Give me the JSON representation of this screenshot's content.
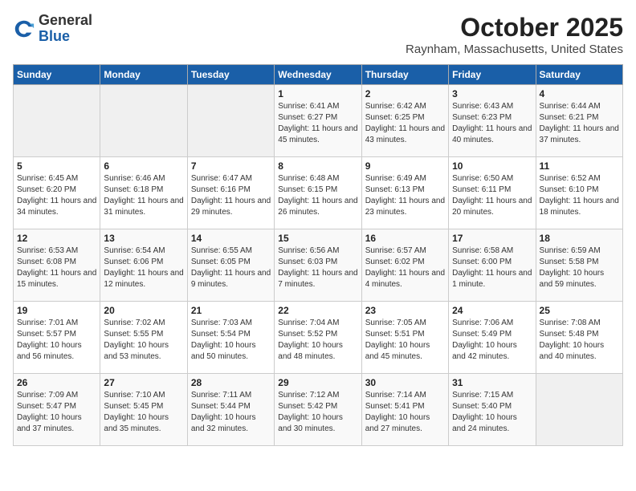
{
  "header": {
    "logo_general": "General",
    "logo_blue": "Blue",
    "month": "October 2025",
    "location": "Raynham, Massachusetts, United States"
  },
  "weekdays": [
    "Sunday",
    "Monday",
    "Tuesday",
    "Wednesday",
    "Thursday",
    "Friday",
    "Saturday"
  ],
  "weeks": [
    [
      {
        "day": "",
        "sunrise": "",
        "sunset": "",
        "daylight": ""
      },
      {
        "day": "",
        "sunrise": "",
        "sunset": "",
        "daylight": ""
      },
      {
        "day": "",
        "sunrise": "",
        "sunset": "",
        "daylight": ""
      },
      {
        "day": "1",
        "sunrise": "Sunrise: 6:41 AM",
        "sunset": "Sunset: 6:27 PM",
        "daylight": "Daylight: 11 hours and 45 minutes."
      },
      {
        "day": "2",
        "sunrise": "Sunrise: 6:42 AM",
        "sunset": "Sunset: 6:25 PM",
        "daylight": "Daylight: 11 hours and 43 minutes."
      },
      {
        "day": "3",
        "sunrise": "Sunrise: 6:43 AM",
        "sunset": "Sunset: 6:23 PM",
        "daylight": "Daylight: 11 hours and 40 minutes."
      },
      {
        "day": "4",
        "sunrise": "Sunrise: 6:44 AM",
        "sunset": "Sunset: 6:21 PM",
        "daylight": "Daylight: 11 hours and 37 minutes."
      }
    ],
    [
      {
        "day": "5",
        "sunrise": "Sunrise: 6:45 AM",
        "sunset": "Sunset: 6:20 PM",
        "daylight": "Daylight: 11 hours and 34 minutes."
      },
      {
        "day": "6",
        "sunrise": "Sunrise: 6:46 AM",
        "sunset": "Sunset: 6:18 PM",
        "daylight": "Daylight: 11 hours and 31 minutes."
      },
      {
        "day": "7",
        "sunrise": "Sunrise: 6:47 AM",
        "sunset": "Sunset: 6:16 PM",
        "daylight": "Daylight: 11 hours and 29 minutes."
      },
      {
        "day": "8",
        "sunrise": "Sunrise: 6:48 AM",
        "sunset": "Sunset: 6:15 PM",
        "daylight": "Daylight: 11 hours and 26 minutes."
      },
      {
        "day": "9",
        "sunrise": "Sunrise: 6:49 AM",
        "sunset": "Sunset: 6:13 PM",
        "daylight": "Daylight: 11 hours and 23 minutes."
      },
      {
        "day": "10",
        "sunrise": "Sunrise: 6:50 AM",
        "sunset": "Sunset: 6:11 PM",
        "daylight": "Daylight: 11 hours and 20 minutes."
      },
      {
        "day": "11",
        "sunrise": "Sunrise: 6:52 AM",
        "sunset": "Sunset: 6:10 PM",
        "daylight": "Daylight: 11 hours and 18 minutes."
      }
    ],
    [
      {
        "day": "12",
        "sunrise": "Sunrise: 6:53 AM",
        "sunset": "Sunset: 6:08 PM",
        "daylight": "Daylight: 11 hours and 15 minutes."
      },
      {
        "day": "13",
        "sunrise": "Sunrise: 6:54 AM",
        "sunset": "Sunset: 6:06 PM",
        "daylight": "Daylight: 11 hours and 12 minutes."
      },
      {
        "day": "14",
        "sunrise": "Sunrise: 6:55 AM",
        "sunset": "Sunset: 6:05 PM",
        "daylight": "Daylight: 11 hours and 9 minutes."
      },
      {
        "day": "15",
        "sunrise": "Sunrise: 6:56 AM",
        "sunset": "Sunset: 6:03 PM",
        "daylight": "Daylight: 11 hours and 7 minutes."
      },
      {
        "day": "16",
        "sunrise": "Sunrise: 6:57 AM",
        "sunset": "Sunset: 6:02 PM",
        "daylight": "Daylight: 11 hours and 4 minutes."
      },
      {
        "day": "17",
        "sunrise": "Sunrise: 6:58 AM",
        "sunset": "Sunset: 6:00 PM",
        "daylight": "Daylight: 11 hours and 1 minute."
      },
      {
        "day": "18",
        "sunrise": "Sunrise: 6:59 AM",
        "sunset": "Sunset: 5:58 PM",
        "daylight": "Daylight: 10 hours and 59 minutes."
      }
    ],
    [
      {
        "day": "19",
        "sunrise": "Sunrise: 7:01 AM",
        "sunset": "Sunset: 5:57 PM",
        "daylight": "Daylight: 10 hours and 56 minutes."
      },
      {
        "day": "20",
        "sunrise": "Sunrise: 7:02 AM",
        "sunset": "Sunset: 5:55 PM",
        "daylight": "Daylight: 10 hours and 53 minutes."
      },
      {
        "day": "21",
        "sunrise": "Sunrise: 7:03 AM",
        "sunset": "Sunset: 5:54 PM",
        "daylight": "Daylight: 10 hours and 50 minutes."
      },
      {
        "day": "22",
        "sunrise": "Sunrise: 7:04 AM",
        "sunset": "Sunset: 5:52 PM",
        "daylight": "Daylight: 10 hours and 48 minutes."
      },
      {
        "day": "23",
        "sunrise": "Sunrise: 7:05 AM",
        "sunset": "Sunset: 5:51 PM",
        "daylight": "Daylight: 10 hours and 45 minutes."
      },
      {
        "day": "24",
        "sunrise": "Sunrise: 7:06 AM",
        "sunset": "Sunset: 5:49 PM",
        "daylight": "Daylight: 10 hours and 42 minutes."
      },
      {
        "day": "25",
        "sunrise": "Sunrise: 7:08 AM",
        "sunset": "Sunset: 5:48 PM",
        "daylight": "Daylight: 10 hours and 40 minutes."
      }
    ],
    [
      {
        "day": "26",
        "sunrise": "Sunrise: 7:09 AM",
        "sunset": "Sunset: 5:47 PM",
        "daylight": "Daylight: 10 hours and 37 minutes."
      },
      {
        "day": "27",
        "sunrise": "Sunrise: 7:10 AM",
        "sunset": "Sunset: 5:45 PM",
        "daylight": "Daylight: 10 hours and 35 minutes."
      },
      {
        "day": "28",
        "sunrise": "Sunrise: 7:11 AM",
        "sunset": "Sunset: 5:44 PM",
        "daylight": "Daylight: 10 hours and 32 minutes."
      },
      {
        "day": "29",
        "sunrise": "Sunrise: 7:12 AM",
        "sunset": "Sunset: 5:42 PM",
        "daylight": "Daylight: 10 hours and 30 minutes."
      },
      {
        "day": "30",
        "sunrise": "Sunrise: 7:14 AM",
        "sunset": "Sunset: 5:41 PM",
        "daylight": "Daylight: 10 hours and 27 minutes."
      },
      {
        "day": "31",
        "sunrise": "Sunrise: 7:15 AM",
        "sunset": "Sunset: 5:40 PM",
        "daylight": "Daylight: 10 hours and 24 minutes."
      },
      {
        "day": "",
        "sunrise": "",
        "sunset": "",
        "daylight": ""
      }
    ]
  ]
}
